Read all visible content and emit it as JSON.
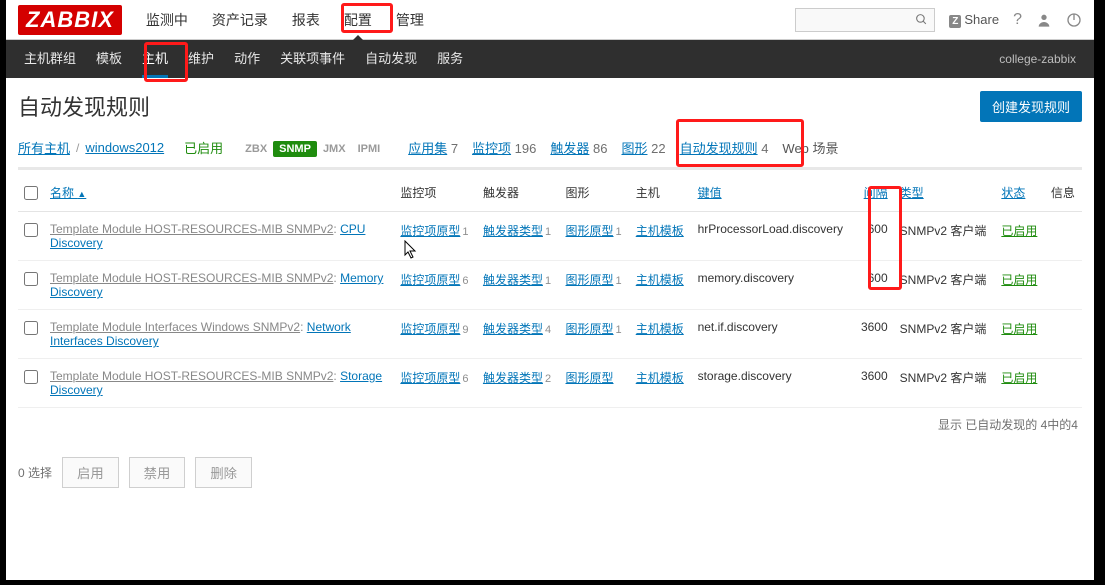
{
  "brand": "ZABBIX",
  "topnav": [
    "监测中",
    "资产记录",
    "报表",
    "配置",
    "管理"
  ],
  "topnav_active": 3,
  "topnav_right": {
    "share": "Share"
  },
  "subnav": [
    "主机群组",
    "模板",
    "主机",
    "维护",
    "动作",
    "关联项事件",
    "自动发现",
    "服务"
  ],
  "subnav_active": 2,
  "subnav_right": "college-zabbix",
  "page_title": "自动发现规则",
  "create_btn": "创建发现规则",
  "breadcrumb": {
    "all_hosts": "所有主机",
    "host": "windows2012",
    "status": "已启用"
  },
  "flags": [
    {
      "t": "ZBX",
      "c": ""
    },
    {
      "t": "SNMP",
      "c": "snmp"
    },
    {
      "t": "JMX",
      "c": ""
    },
    {
      "t": "IPMI",
      "c": ""
    }
  ],
  "navtabs": [
    {
      "label": "应用集",
      "n": "7"
    },
    {
      "label": "监控项",
      "n": "196"
    },
    {
      "label": "触发器",
      "n": "86"
    },
    {
      "label": "图形",
      "n": "22"
    },
    {
      "label": "自动发现规则",
      "n": "4"
    },
    {
      "label": "Web 场景",
      "n": ""
    }
  ],
  "headers": {
    "name": "名称",
    "items": "监控项",
    "triggers": "触发器",
    "graphs": "图形",
    "hosts": "主机",
    "key": "键值",
    "interval": "间隔",
    "type": "类型",
    "status": "状态",
    "info": "信息"
  },
  "rows": [
    {
      "tpl": "Template Module HOST-RESOURCES-MIB SNMPv2",
      "name": "CPU Discovery",
      "items": "监控项原型",
      "in": "1",
      "trg": "触发器类型",
      "tn": "1",
      "gra": "图形原型",
      "gn": "1",
      "host": "主机模板",
      "key": "hrProcessorLoad.discovery",
      "intv": "600",
      "type": "SNMPv2 客户端",
      "status": "已启用"
    },
    {
      "tpl": "Template Module HOST-RESOURCES-MIB SNMPv2",
      "name": "Memory Discovery",
      "items": "监控项原型",
      "in": "6",
      "trg": "触发器类型",
      "tn": "1",
      "gra": "图形原型",
      "gn": "1",
      "host": "主机模板",
      "key": "memory.discovery",
      "intv": "600",
      "type": "SNMPv2 客户端",
      "status": "已启用"
    },
    {
      "tpl": "Template Module Interfaces Windows SNMPv2",
      "name": "Network Interfaces Discovery",
      "items": "监控项原型",
      "in": "9",
      "trg": "触发器类型",
      "tn": "4",
      "gra": "图形原型",
      "gn": "1",
      "host": "主机模板",
      "key": "net.if.discovery",
      "intv": "3600",
      "type": "SNMPv2 客户端",
      "status": "已启用"
    },
    {
      "tpl": "Template Module HOST-RESOURCES-MIB SNMPv2",
      "name": "Storage Discovery",
      "items": "监控项原型",
      "in": "6",
      "trg": "触发器类型",
      "tn": "2",
      "gra": "图形原型",
      "gn": "",
      "host": "主机模板",
      "key": "storage.discovery",
      "intv": "3600",
      "type": "SNMPv2 客户端",
      "status": "已启用"
    }
  ],
  "footer": "显示 已自动发现的 4中的4",
  "actions": {
    "sel": "0 选择",
    "enable": "启用",
    "disable": "禁用",
    "delete": "删除"
  }
}
